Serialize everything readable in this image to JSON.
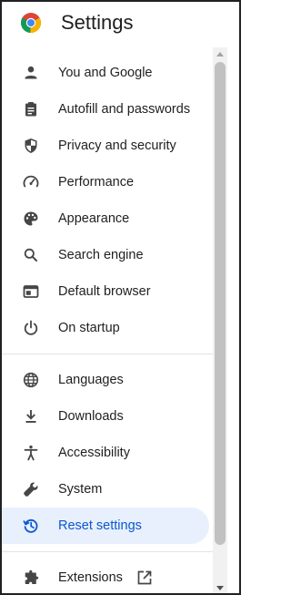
{
  "header": {
    "title": "Settings"
  },
  "colors": {
    "accent": "#0b57d0",
    "active_bg": "#e8f0fe",
    "icon": "#444746"
  },
  "menu": {
    "group1": [
      {
        "label": "You and Google",
        "icon": "person-icon"
      },
      {
        "label": "Autofill and passwords",
        "icon": "clipboard-icon"
      },
      {
        "label": "Privacy and security",
        "icon": "shield-icon"
      },
      {
        "label": "Performance",
        "icon": "speedometer-icon"
      },
      {
        "label": "Appearance",
        "icon": "palette-icon"
      },
      {
        "label": "Search engine",
        "icon": "search-icon"
      },
      {
        "label": "Default browser",
        "icon": "browser-window-icon"
      },
      {
        "label": "On startup",
        "icon": "power-icon"
      }
    ],
    "group2": [
      {
        "label": "Languages",
        "icon": "globe-icon"
      },
      {
        "label": "Downloads",
        "icon": "download-icon"
      },
      {
        "label": "Accessibility",
        "icon": "accessibility-icon"
      },
      {
        "label": "System",
        "icon": "wrench-icon"
      },
      {
        "label": "Reset settings",
        "icon": "reset-history-icon",
        "active": true
      }
    ],
    "group3": [
      {
        "label": "Extensions",
        "icon": "puzzle-icon",
        "trailing_icon": "open-in-new-icon"
      }
    ]
  }
}
